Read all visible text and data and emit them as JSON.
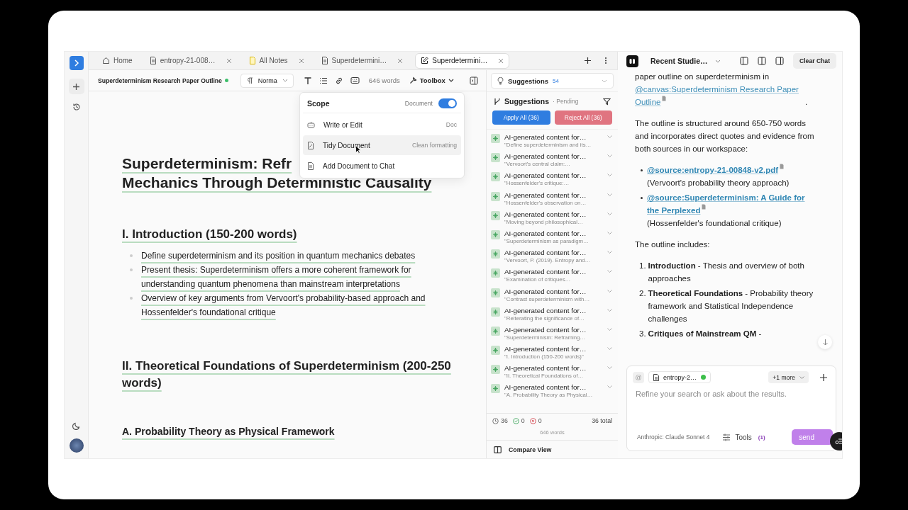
{
  "tabs": [
    {
      "label": "Home",
      "kind": "home",
      "closable": false,
      "selected": false
    },
    {
      "label": "entropy-21-008…",
      "kind": "doc",
      "closable": true,
      "selected": false
    },
    {
      "label": "All Notes",
      "kind": "note",
      "closable": true,
      "selected": false
    },
    {
      "label": "Superdetermini…",
      "kind": "doc",
      "closable": true,
      "selected": false
    },
    {
      "label": "Superdetermini…",
      "kind": "edit",
      "closable": true,
      "selected": true
    }
  ],
  "editor_toolbar": {
    "document_title": "Superdeterminism Research Paper Outline",
    "saved": true,
    "style_select": "Norma",
    "word_count": "646 words",
    "toolbox_label": "Toolbox"
  },
  "toolbox_menu": {
    "scope_label": "Scope",
    "scope_value": "Document",
    "scope_on": true,
    "items": [
      {
        "label": "Write or Edit",
        "hint": "Doc",
        "kind": "robot",
        "highlighted": false
      },
      {
        "label": "Tidy Document",
        "hint": "Clean formatting",
        "kind": "tidy",
        "highlighted": true
      },
      {
        "label": "Add Document to Chat",
        "kind": "doc",
        "highlighted": false
      }
    ]
  },
  "document": {
    "title_line_1": "Superdeterminism: Refr",
    "title_line_2": "Mechanics Through Deterministic Causality",
    "sections": [
      {
        "kind": "h2",
        "heading": "I. Introduction (150-200 words)",
        "bullets": [
          "Define superdeterminism and its position in quantum mechanics debates",
          "Present thesis: Superdeterminism offers a more coherent framework for understanding quantum phenomena than mainstream interpretations",
          "Overview of key arguments from Vervoort's probability-based approach and Hossenfelder's foundational critique"
        ]
      },
      {
        "kind": "h2",
        "heading": "II. Theoretical Foundations of Superdeterminism (200-250 words)"
      },
      {
        "kind": "h3",
        "heading": "A. Probability Theory as Physical Framework"
      }
    ]
  },
  "suggestions_panel": {
    "selector_label": "Suggestions",
    "selector_count": "54",
    "header": "Suggestions",
    "status": "· Pending",
    "apply_all": "Apply All (36)",
    "reject_all": "Reject All (36)",
    "items": [
      {
        "title": "AI-generated content for…",
        "excerpt": "\"Define superdeterminism and its…"
      },
      {
        "title": "AI-generated content for…",
        "excerpt": "\"Vervoort's central claim:…"
      },
      {
        "title": "AI-generated content for…",
        "excerpt": "\"Hossenfelder's critique:…"
      },
      {
        "title": "AI-generated content for…",
        "excerpt": "\"Hossenfelder's observation on…"
      },
      {
        "title": "AI-generated content for…",
        "excerpt": "\"Moving beyond philosophical…"
      },
      {
        "title": "AI-generated content for…",
        "excerpt": "\"Superdeterminism as paradigm…"
      },
      {
        "title": "AI-generated content for…",
        "excerpt": "\"Vervoort, P. (2019). Entropy and…"
      },
      {
        "title": "AI-generated content for…",
        "excerpt": "\"Examination of critiques…"
      },
      {
        "title": "AI-generated content for…",
        "excerpt": "\"Contrast superdeterminism with…"
      },
      {
        "title": "AI-generated content for…",
        "excerpt": "\"Reiterating the significance of…"
      },
      {
        "title": "AI-generated content for…",
        "excerpt": "\"Superdeterminism: Reframing…"
      },
      {
        "title": "AI-generated content for…",
        "excerpt": "\"I. Introduction (150-200 words)\""
      },
      {
        "title": "AI-generated content for…",
        "excerpt": "\"II. Theoretical Foundations of…"
      },
      {
        "title": "AI-generated content for…",
        "excerpt": "\"A. Probability Theory as Physical…"
      }
    ],
    "footer": {
      "pending": "36",
      "accepted": "0",
      "rejected": "0",
      "total": "36 total",
      "words": "646 words"
    },
    "compare_view": "Compare View"
  },
  "chat": {
    "conversation_select": "Recent Studie…",
    "clear_button": "Clear Chat",
    "blocks": [
      {
        "kind": "link_paragraph",
        "before": "paper outline on superdeterminism in",
        "link": "@canvas:Superdeterminism Research Paper Outline",
        "after": "."
      },
      {
        "kind": "paragraph",
        "text": "The outline is structured around 650-750 words and incorporates direct quotes and evidence from both sources in our workspace:"
      },
      {
        "kind": "sources",
        "items": [
          {
            "link": "@source:entropy-21-00848-v2.pdf",
            "note": "(Vervoort's probability theory approach)"
          },
          {
            "link": "@source:Superdeterminism: A Guide for the Perplexed",
            "note": "(Hossenfelder's foundational critique)"
          }
        ]
      },
      {
        "kind": "paragraph",
        "text": "The outline includes:"
      },
      {
        "kind": "numbered",
        "items": [
          {
            "number": "1.",
            "text": "**Introduction** - Thesis and overview of both approaches"
          },
          {
            "number": "2.",
            "text": "**Theoretical Foundations** - Probability theory framework and Statistical Independence challenges"
          },
          {
            "number": "3.",
            "text": "**Critiques of Mainstream QM** -"
          }
        ]
      }
    ],
    "input": {
      "mention_button": "@",
      "attachment": "entropy-2…",
      "more_attachments": "+1 more",
      "placeholder": "Refine your search or ask about the results.",
      "model": "Anthropic: Claude Sonnet 4",
      "tools_label": "Tools",
      "tools_count": "(1)",
      "send_button": "send"
    }
  }
}
